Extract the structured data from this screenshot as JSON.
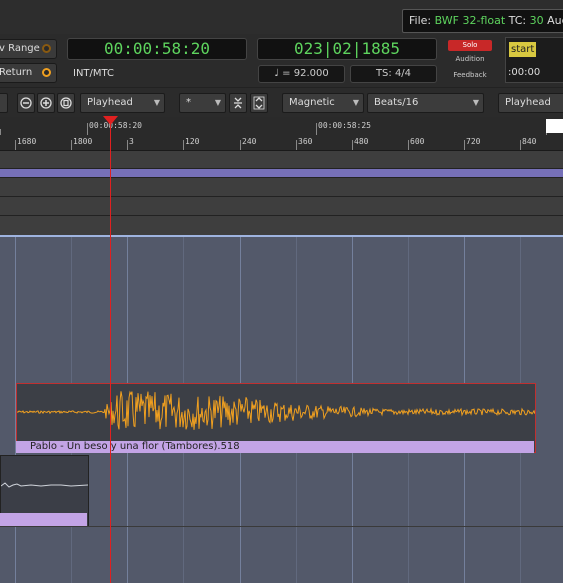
{
  "status": {
    "file_label": "File:",
    "file_format": "BWF 32-float",
    "tc_label": "TC:",
    "tc_value": "30",
    "audio_label": "Audio"
  },
  "transport": {
    "range_label": "v Range",
    "return_label": "Return",
    "primary_clock": "00:00:58:20",
    "secondary_clock": "023|02|1885",
    "sync_source": "INT/MTC",
    "tempo": "♩ = 92.000",
    "time_signature": "TS: 4/4",
    "solo_label": "Solo",
    "audition_label": "Audition",
    "feedback_label": "Feedback",
    "start_label": "start",
    "start_time": ":00:00"
  },
  "toolbar": {
    "edit_point": "Playhead",
    "nudge_value": "*",
    "snap_mode": "Magnetic",
    "grid_type": "Beats/16",
    "right_edit_point": "Playhead"
  },
  "ruler_timecode": {
    "labels": [
      "00:00:58:20",
      "00:00:58:25"
    ]
  },
  "ruler_samples": {
    "labels": [
      "1680",
      "1800",
      "3",
      "120",
      "240",
      "360",
      "480",
      "600",
      "720",
      "840"
    ]
  },
  "regions": {
    "main_name": "Pablo - Un beso y una flor (Tambores).518"
  },
  "colors": {
    "waveform": "#f0a020",
    "region_name_bar": "#c3a4e6",
    "playhead": "#e02020",
    "clock_text": "#5ed45e"
  }
}
